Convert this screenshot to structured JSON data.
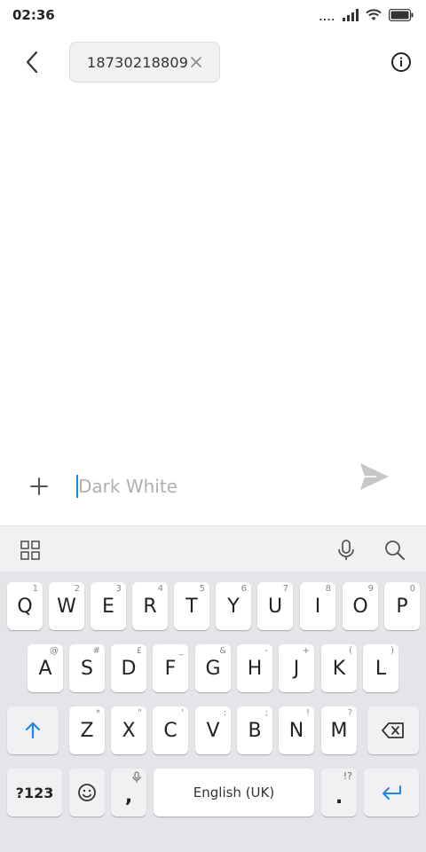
{
  "status_bar": {
    "time": "02:36",
    "dots": "...."
  },
  "header": {
    "recipient_number": "18730218809"
  },
  "composer": {
    "placeholder": "Dark White"
  },
  "keyboard": {
    "row1": [
      {
        "label": "Q",
        "hint": "1"
      },
      {
        "label": "W",
        "hint": "2"
      },
      {
        "label": "E",
        "hint": "3"
      },
      {
        "label": "R",
        "hint": "4"
      },
      {
        "label": "T",
        "hint": "5"
      },
      {
        "label": "Y",
        "hint": "6"
      },
      {
        "label": "U",
        "hint": "7"
      },
      {
        "label": "I",
        "hint": "8"
      },
      {
        "label": "O",
        "hint": "9"
      },
      {
        "label": "P",
        "hint": "0"
      }
    ],
    "row2": [
      {
        "label": "A",
        "hint": "@"
      },
      {
        "label": "S",
        "hint": "#"
      },
      {
        "label": "D",
        "hint": "£"
      },
      {
        "label": "F",
        "hint": "_"
      },
      {
        "label": "G",
        "hint": "&"
      },
      {
        "label": "H",
        "hint": "-"
      },
      {
        "label": "J",
        "hint": "+"
      },
      {
        "label": "K",
        "hint": "("
      },
      {
        "label": "L",
        "hint": ")"
      }
    ],
    "row3": [
      {
        "label": "Z",
        "hint": "*"
      },
      {
        "label": "X",
        "hint": "\""
      },
      {
        "label": "C",
        "hint": "'"
      },
      {
        "label": "V",
        "hint": ":"
      },
      {
        "label": "B",
        "hint": ";"
      },
      {
        "label": "N",
        "hint": "!"
      },
      {
        "label": "M",
        "hint": "?"
      }
    ],
    "symbols_label": "?123",
    "comma_label": ",",
    "space_label": "English (UK)",
    "period_label": ".",
    "period_hint": "!?"
  },
  "colors": {
    "accent": "#1e88e5",
    "keyboard_bg": "#e4e5e8",
    "toolbar_bg": "#f1f2f4"
  }
}
